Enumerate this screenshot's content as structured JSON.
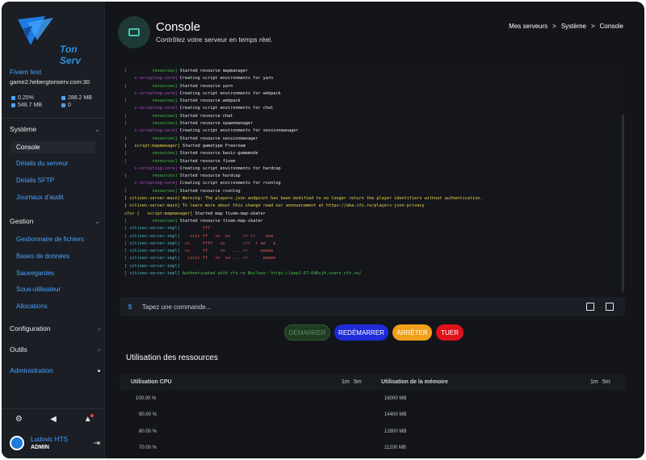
{
  "logo": {
    "text": "Ton Serv"
  },
  "server": {
    "name": "Fivem test",
    "host": "game2.hebergtonserv.com:30",
    "stats": [
      "0.25%",
      "288.2 MB",
      "548.7 MB",
      "0"
    ]
  },
  "nav": {
    "systeme": "Système",
    "console": "Console",
    "details": "Détails du serveur",
    "sftp": "Details SFTP",
    "audit": "Journaux d'audit",
    "gestion": "Gestion",
    "fichiers": "Gestionnaire de fichiers",
    "bdd": "Bases de données",
    "sauvegardes": "Sauvegardes",
    "sous": "Sous-utilisateur",
    "allocations": "Allocations",
    "configuration": "Configuration",
    "outils": "Outils",
    "administration": "Administration"
  },
  "user": {
    "name": "Ludovic HTS",
    "role": "ADMIN"
  },
  "header": {
    "title": "Console",
    "subtitle": "Contrôlez votre serveur en temps réel.",
    "crumbs": [
      "Mes serveurs",
      ">",
      "Système",
      ">",
      "Console"
    ]
  },
  "console_lines": [
    {
      "tag": "[          resources]",
      "msg": " Started resource mapmanager",
      "cls": "g"
    },
    {
      "tag": "    c-scripting-core]",
      "msg": " Creating script environments for yarn",
      "cls": "p"
    },
    {
      "tag": "[          resources]",
      "msg": " Started resource yarn",
      "cls": "g"
    },
    {
      "tag": "    c-scripting-core]",
      "msg": " Creating script environments for webpack",
      "cls": "p"
    },
    {
      "tag": "[          resources]",
      "msg": " Started resource webpack",
      "cls": "g"
    },
    {
      "tag": "    c-scripting-core]",
      "msg": " Creating script environments for chat",
      "cls": "p"
    },
    {
      "tag": "[          resources]",
      "msg": " Started resource chat",
      "cls": "g"
    },
    {
      "tag": "[          resources]",
      "msg": " Started resource spawnmanager",
      "cls": "g"
    },
    {
      "tag": "    c-scripting-core]",
      "msg": " Creating script environments for sessionmanager",
      "cls": "p"
    },
    {
      "tag": "[          resources]",
      "msg": " Started resource sessionmanager",
      "cls": "g"
    },
    {
      "tag": "[   script:mapmanager]",
      "msg": " Started gametype Freeroam",
      "cls": "y"
    },
    {
      "tag": "[          resources]",
      "msg": " Started resource basic-gamemode",
      "cls": "g"
    },
    {
      "tag": "[          resources]",
      "msg": " Started resource fivem",
      "cls": "g"
    },
    {
      "tag": "    c-scripting-core]",
      "msg": " Creating script environments for hardcap",
      "cls": "p"
    },
    {
      "tag": "[          resources]",
      "msg": " Started resource hardcap",
      "cls": "g"
    },
    {
      "tag": "    c-scripting-core]",
      "msg": " Creating script environments for rconlog",
      "cls": "p"
    },
    {
      "tag": "[          resources]",
      "msg": " Started resource rconlog",
      "cls": "g"
    },
    {
      "tag": "[ citizen-server-main]",
      "msg": " Warning: The players.json endpoint has been modified to no longer return the player identifiers without authentication.",
      "cls": "y",
      "msgcls": "y"
    },
    {
      "tag": "[ citizen-server-main]",
      "msg": " To learn more about this change read our announcement at https://aka.cfx.re/players-json-privacy",
      "cls": "y",
      "msgcls": "y"
    },
    {
      "tag": "cfx> [   script:mapmanager]",
      "msg": " Started map fivem-map-skater",
      "cls": "y"
    },
    {
      "tag": "[          resources]",
      "msg": " Started resource fivem-map-skater",
      "cls": "g"
    },
    {
      "tag": "[ citizen-server-impl]",
      "msg": "         fff",
      "cls": "c",
      "msgcls": "r"
    },
    {
      "tag": "[ citizen-server-impl]",
      "msg": "    cccc ff   xx  xx     rr rr    eee",
      "cls": "c",
      "msgcls": "r"
    },
    {
      "tag": "[ citizen-server-impl]",
      "msg": "  cc     ffff   xx       rrr  r ee   e",
      "cls": "c",
      "msgcls": "r"
    },
    {
      "tag": "[ citizen-server-impl]",
      "msg": "  cc     ff     xx   ... rr     eeeee",
      "cls": "c",
      "msgcls": "r"
    },
    {
      "tag": "[ citizen-server-impl]",
      "msg": "   ccccc ff   xx  xx ... rr      eeeee",
      "cls": "c",
      "msgcls": "r"
    },
    {
      "tag": "[ citizen-server-impl]",
      "msg": "",
      "cls": "c"
    },
    {
      "tag": "[ citizen-server-impl]",
      "msg": " Authenticated with cfx.re Nucleus: https://pap1-67-646cj4.users.cfx.re/",
      "cls": "c",
      "msgcls": "g"
    }
  ],
  "command": {
    "placeholder": "Tapez une commande..."
  },
  "power": {
    "start": "DÉMARRER",
    "restart": "REDÉMARRER",
    "stop": "ARRÊTER",
    "kill": "TUER"
  },
  "resources": {
    "title": "Utilisation des ressources",
    "cpu_label": "Utilisation CPU",
    "mem_label": "Utilisation de la mémoire",
    "range1": "1m",
    "range2": "5m",
    "cpu_ticks": [
      "100.00 %",
      "90.00 %",
      "80.00 %",
      "70.00 %"
    ],
    "mem_ticks": [
      "16000 MB",
      "14400 MB",
      "12800 MB",
      "11200 MB"
    ]
  },
  "colors": {
    "accent": "#4aa3ff",
    "green": "#4ec34e",
    "purple": "#c04bcf",
    "yellow": "#f0d350"
  }
}
